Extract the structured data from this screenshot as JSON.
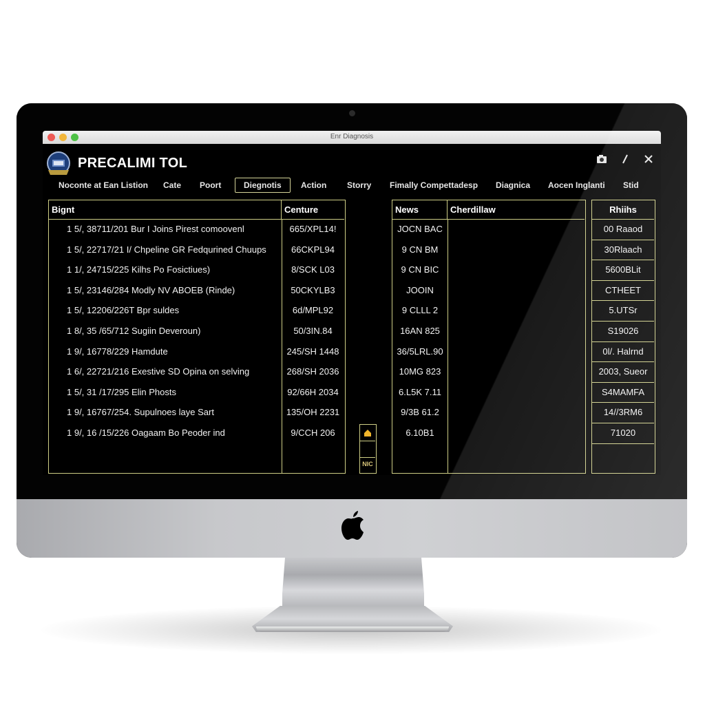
{
  "window": {
    "title": "Enr Diagnosis",
    "app_title": "PRECALIMI TOL",
    "header_icons": [
      "camera-icon",
      "edit-icon",
      "close-icon"
    ]
  },
  "tabs": [
    {
      "label": "Noconte at Ean Listion",
      "active": false
    },
    {
      "label": "Cate",
      "active": false
    },
    {
      "label": "Poort",
      "active": false
    },
    {
      "label": "Diegnotis",
      "active": true
    },
    {
      "label": "Action",
      "active": false
    },
    {
      "label": "Storry",
      "active": false
    },
    {
      "label": "Fimally Compettadesp",
      "active": false
    },
    {
      "label": "Diagnica",
      "active": false
    },
    {
      "label": "Aocen Inglanti",
      "active": false
    },
    {
      "label": "Stid",
      "active": false
    }
  ],
  "left_table": {
    "headers": [
      "Bignt",
      "Centure"
    ],
    "rows": [
      [
        "1 5/, 38711/201 Bur I Joins Pirest comoovenl",
        "665/XPL14!"
      ],
      [
        "1 5/, 22717/21 I/ Chpeline GR Fedqurined Chuups",
        "66CKPL94"
      ],
      [
        "1 1/, 24715/225 Kilhs Po Fosictiues)",
        "8/SCK L03"
      ],
      [
        "1 5/, 23146/284 Modly NV ABOEB (Rinde)",
        "50CKYLB3"
      ],
      [
        "1 5/, 12206/226T Bpr suldes",
        "6d/MPL92"
      ],
      [
        "1 8/, 35 /65/712 Sugiin Deveroun)",
        "50/3IN.84"
      ],
      [
        "1 9/, 16778/229 Hamdute",
        "245/SH 1448"
      ],
      [
        "1 6/, 22721/216 Exestive SD Opina on selving",
        "268/SH 2036"
      ],
      [
        "1 5/, 31 /17/295 Elin Phosts",
        "92/66H 2034"
      ],
      [
        "1 9/, 16767/254.  Supulnoes laye Sart",
        "135/OH 2231"
      ],
      [
        "1 9/, 16 /15/226 Oagaam Bo Peoder ind",
        "9/CCH 206"
      ]
    ]
  },
  "scroll_widget": {
    "top_icon": "lock-icon",
    "bottom_label": "NIC"
  },
  "middle_table": {
    "headers": [
      "News",
      "Cherdillaw"
    ],
    "rows": [
      "JOCN BAC",
      "9 CN BM",
      "9 CN BIC",
      "JOOIN",
      "9 CLLL 2",
      "16AN 825",
      "36/5LRL.90",
      "10MG 823",
      "6.L5K 7.11",
      "9/3B 61.2",
      "6.10B1"
    ]
  },
  "right_table": {
    "header": "Rhiihs",
    "rows": [
      "00 Raaod",
      "30Rlaach",
      "5600BLit",
      "CTHEET",
      "5.UTSr",
      "S19026",
      "0l/. Halrnd",
      "2003, Sueor",
      "S4MAMFA",
      "14//3RM6",
      "71020",
      ""
    ]
  },
  "colors": {
    "accent_border": "#cfcf86",
    "background": "#000000",
    "text": "#f2f2f2"
  }
}
